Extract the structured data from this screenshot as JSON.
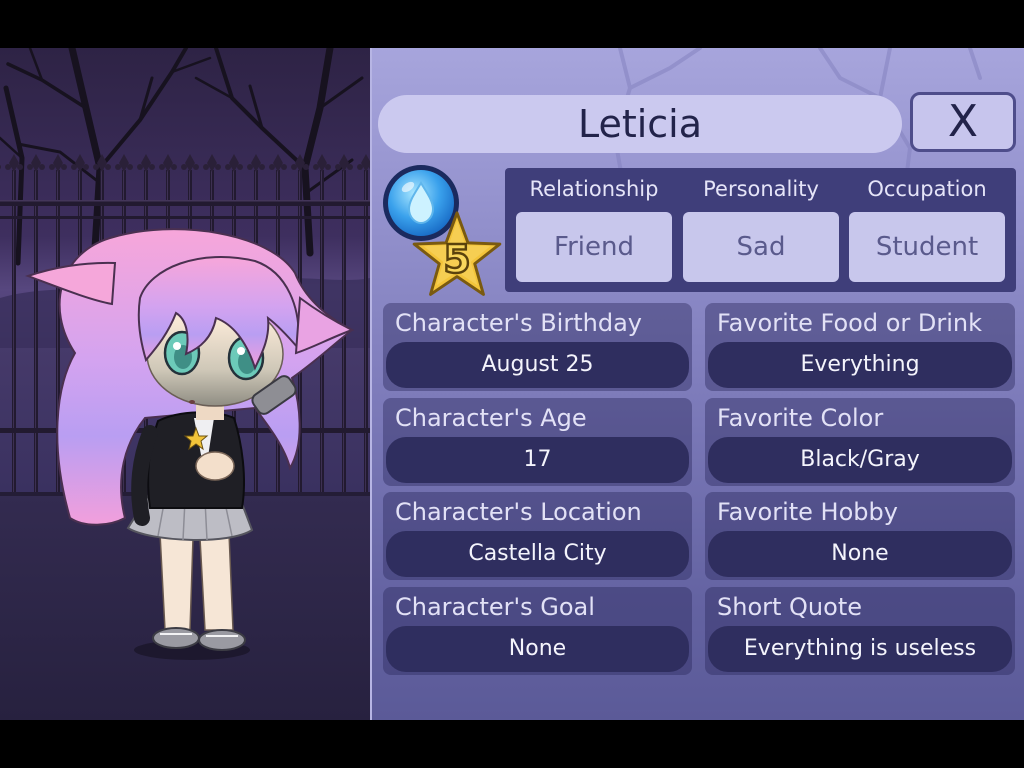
{
  "character": {
    "name": "Leticia"
  },
  "close_button": {
    "label": "X"
  },
  "level": {
    "value": "5"
  },
  "summary": [
    {
      "label": "Relationship",
      "value": "Friend"
    },
    {
      "label": "Personality",
      "value": "Sad"
    },
    {
      "label": "Occupation",
      "value": "Student"
    }
  ],
  "fields": [
    {
      "label": "Character's Birthday",
      "value": "August 25"
    },
    {
      "label": "Favorite Food or Drink",
      "value": "Everything"
    },
    {
      "label": "Character's Age",
      "value": "17"
    },
    {
      "label": "Favorite Color",
      "value": "Black/Gray"
    },
    {
      "label": "Character's Location",
      "value": "Castella City"
    },
    {
      "label": "Favorite Hobby",
      "value": "None"
    },
    {
      "label": "Character's Goal",
      "value": "None"
    },
    {
      "label": "Short Quote",
      "value": "Everything is useless"
    }
  ],
  "icons": {
    "orb": "water-drop-icon",
    "badge": "star-icon",
    "close": "close-icon"
  },
  "theme": {
    "panel_top": "#a7a5dc",
    "panel_bottom": "#5b5a98",
    "info_box": "#3f3e7a",
    "value_pill": "#2f2e5f",
    "star_gold": "#f3c43a",
    "orb_blue": "#1b79d6"
  }
}
